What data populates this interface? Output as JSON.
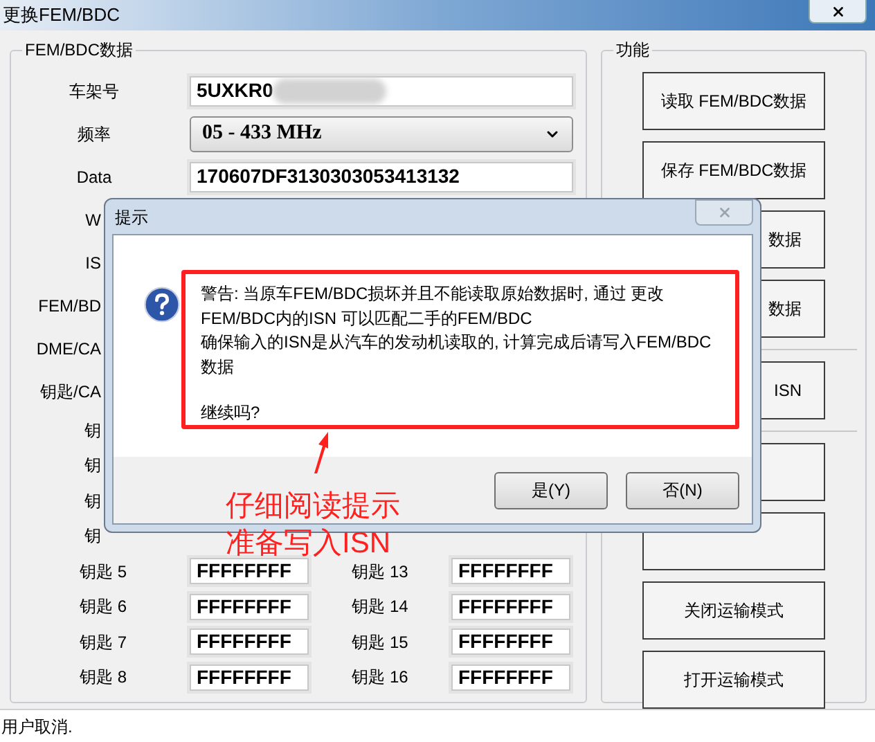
{
  "window": {
    "title": "更换FEM/BDC"
  },
  "data_group": {
    "title": "FEM/BDC数据",
    "rows": [
      {
        "label": "车架号",
        "kind": "text",
        "value": "5UXKR0",
        "redacted": true
      },
      {
        "label": "频率",
        "kind": "select",
        "value": "05 - 433 MHz"
      },
      {
        "label": "Data",
        "kind": "text",
        "value": "170607DF3130303053413132",
        "redacted": false
      },
      {
        "label": "W",
        "kind": "covered"
      },
      {
        "label": "IS",
        "kind": "covered"
      },
      {
        "label": "FEM/BD",
        "kind": "covered"
      },
      {
        "label": "DME/CA",
        "kind": "covered"
      },
      {
        "label": "钥匙/CA",
        "kind": "covered"
      }
    ],
    "keys": [
      {
        "left": {
          "label": "钥"
        }
      },
      {
        "left": {
          "label": "钥"
        }
      },
      {
        "left": {
          "label": "钥"
        }
      },
      {
        "left": {
          "label": "钥"
        }
      },
      {
        "left": {
          "label": "钥匙 5",
          "value": "FFFFFFFF"
        },
        "right": {
          "label": "钥匙 13",
          "value": "FFFFFFFF"
        }
      },
      {
        "left": {
          "label": "钥匙 6",
          "value": "FFFFFFFF"
        },
        "right": {
          "label": "钥匙 14",
          "value": "FFFFFFFF"
        }
      },
      {
        "left": {
          "label": "钥匙 7",
          "value": "FFFFFFFF"
        },
        "right": {
          "label": "钥匙 15",
          "value": "FFFFFFFF"
        }
      },
      {
        "left": {
          "label": "钥匙 8",
          "value": "FFFFFFFF"
        },
        "right": {
          "label": "钥匙 16",
          "value": "FFFFFFFF"
        }
      }
    ]
  },
  "function_group": {
    "title": "功能",
    "button_groups": [
      [
        {
          "kind": "full",
          "label": "读取 FEM/BDC数据"
        },
        {
          "kind": "full",
          "label": "保存 FEM/BDC数据"
        },
        {
          "kind": "partial",
          "label": "数据"
        },
        {
          "kind": "partial",
          "label": "数据"
        }
      ],
      [
        {
          "kind": "partial",
          "label": "ISN"
        }
      ],
      [
        {
          "kind": "covered"
        },
        {
          "kind": "covered"
        },
        {
          "kind": "full",
          "label": "关闭运输模式"
        },
        {
          "kind": "full",
          "label": "打开运输模式"
        }
      ]
    ]
  },
  "dialog": {
    "title": "提示",
    "message": [
      "警告: 当原车FEM/BDC损坏并且不能读取原始数据时, 通过 更改",
      "FEM/BDC内的ISN 可以匹配二手的FEM/BDC",
      "确保输入的ISN是从汽车的发动机读取的, 计算完成后请写入FEM/BDC",
      "数据"
    ],
    "question": "继续吗?",
    "buttons": [
      "是(Y)",
      "否(N)"
    ]
  },
  "annotation": {
    "lines": [
      "仔细阅读提示",
      "准备写入ISN"
    ]
  },
  "status_bar": "用户取消."
}
